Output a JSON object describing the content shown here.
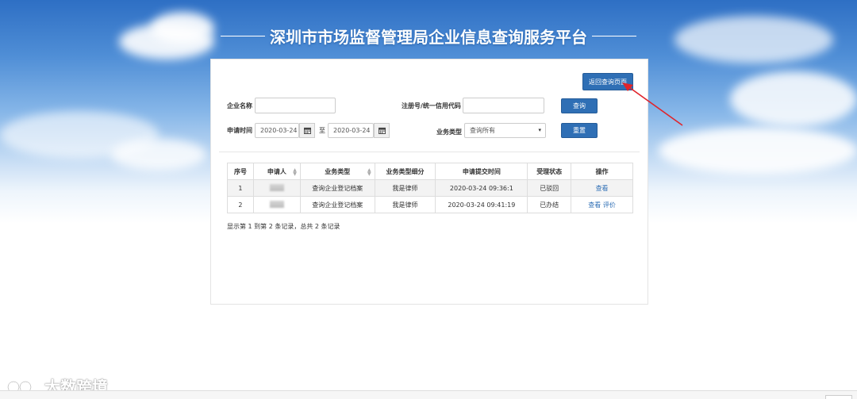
{
  "page": {
    "title": "深圳市市场监督管理局企业信息查询服务平台"
  },
  "toolbar": {
    "back_label": "返回查询页面"
  },
  "form": {
    "company_name_label": "企业名称",
    "company_name_value": "",
    "reg_no_label": "注册号/统一信用代码",
    "reg_no_value": "",
    "query_label": "查询",
    "date_label": "申请时间",
    "date_from": "2020-03-24",
    "date_sep": "至",
    "date_to": "2020-03-24",
    "biz_type_label": "业务类型",
    "biz_type_value": "查询所有",
    "reset_label": "重置"
  },
  "table": {
    "headers": [
      "序号",
      "申请人",
      "业务类型",
      "业务类型细分",
      "申请提交时间",
      "受理状态",
      "操作"
    ],
    "rows": [
      {
        "no": "1",
        "type": "查询企业登记档案",
        "subtype": "我是律师",
        "time": "2020-03-24 09:36:1",
        "status": "已驳回",
        "action1": "查看",
        "action2": ""
      },
      {
        "no": "2",
        "type": "查询企业登记档案",
        "subtype": "我是律师",
        "time": "2020-03-24 09:41:19",
        "status": "已办结",
        "action1": "查看",
        "action2": "评价"
      }
    ],
    "summary": "显示第 1 到第 2 条记录，总共 2 条记录"
  },
  "watermark": {
    "text": "大数跨境"
  },
  "colors": {
    "primary_button": "#2f6fb5",
    "annotation_arrow": "#e0242b"
  }
}
